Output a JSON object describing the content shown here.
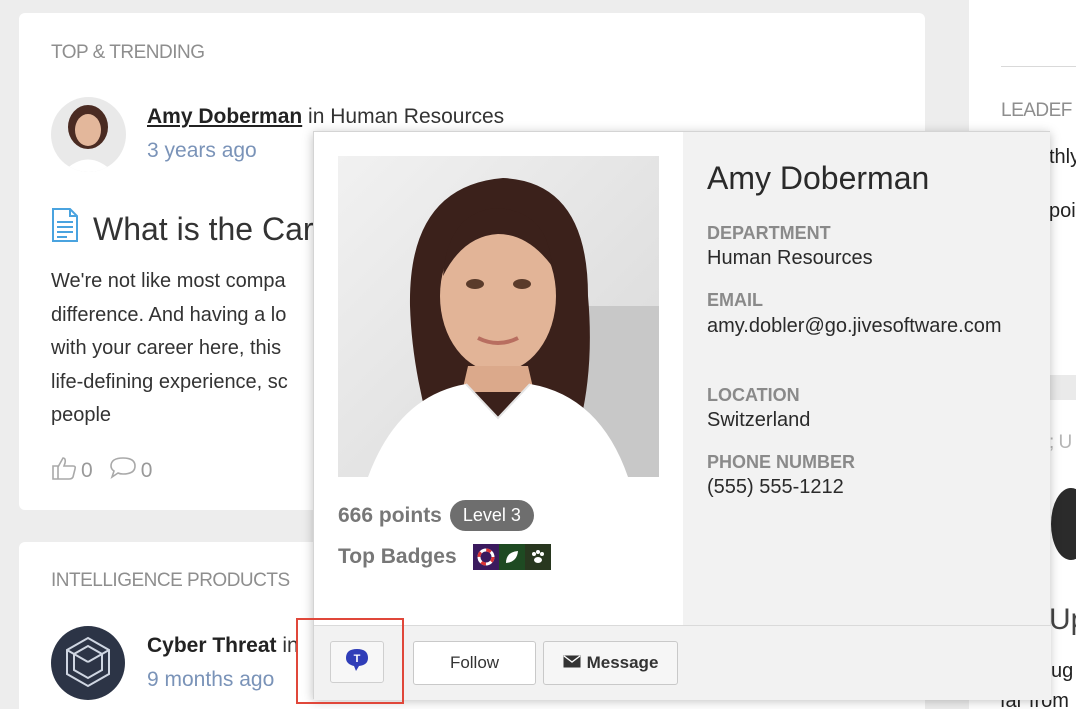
{
  "top_section": {
    "label": "TOP & TRENDING",
    "author_name": "Amy Doberman",
    "in_text": "in",
    "place": "Human Resources",
    "time_ago": "3 years ago",
    "post_title": "What is the Care",
    "post_body": "We're not like most compa difference. And having a lo with your career here, this life-defining experience, sc people",
    "body_lines": [
      "We're not like most compa",
      "difference. And having a lo",
      "with your career here, this",
      "life-defining experience, sc",
      "people"
    ],
    "likes": "0",
    "comments": "0"
  },
  "intel_section": {
    "label": "INTELLIGENCE PRODUCTS",
    "author_name": "Cyber Threat",
    "in_text": "in",
    "time_ago": "9 months ago"
  },
  "right_column": {
    "leader_label": "LEADEF",
    "snippet_1": "thly",
    "snippet_2": "poi",
    "snippet_3": "; U",
    "snippet_4": "Up",
    "snippet_5": "ug",
    "snippet_6": "far from"
  },
  "hovercard": {
    "name": "Amy Doberman",
    "department_label": "DEPARTMENT",
    "department": "Human Resources",
    "email_label": "EMAIL",
    "email": "amy.dobler@go.jivesoftware.com",
    "location_label": "LOCATION",
    "location": "Switzerland",
    "phone_label": "PHONE NUMBER",
    "phone": "(555) 555-1212",
    "points": "666 points",
    "level": "Level 3",
    "top_badges_label": "Top Badges",
    "badges": [
      "lifebuoy-badge",
      "leaf-badge",
      "paw-badge"
    ],
    "follow_label": "Follow",
    "message_label": "Message"
  },
  "colors": {
    "time_ago": "#7a93b8",
    "highlight": "#e0473a",
    "t_button": "#2f3db8"
  }
}
